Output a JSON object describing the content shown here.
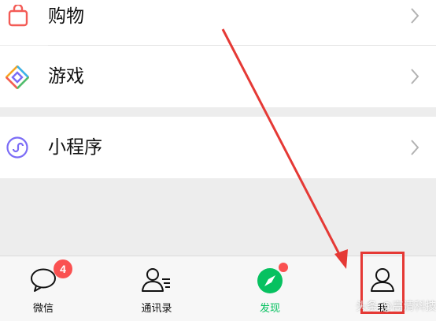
{
  "menu": {
    "items": [
      {
        "label": "购物",
        "icon": "shopping-bag-icon"
      },
      {
        "label": "游戏",
        "icon": "game-diamond-icon"
      },
      {
        "label": "小程序",
        "icon": "mini-program-icon"
      }
    ]
  },
  "tabbar": {
    "tabs": [
      {
        "label": "微信",
        "icon": "chat-bubble-icon",
        "badge": "4"
      },
      {
        "label": "通讯录",
        "icon": "contacts-icon"
      },
      {
        "label": "发现",
        "icon": "compass-icon",
        "active": true
      },
      {
        "label": "我",
        "icon": "person-icon"
      }
    ]
  },
  "watermark": "头条 @高清科技",
  "colors": {
    "accent": "#07c160",
    "badge": "#fa5151",
    "annotation": "#e53935"
  }
}
